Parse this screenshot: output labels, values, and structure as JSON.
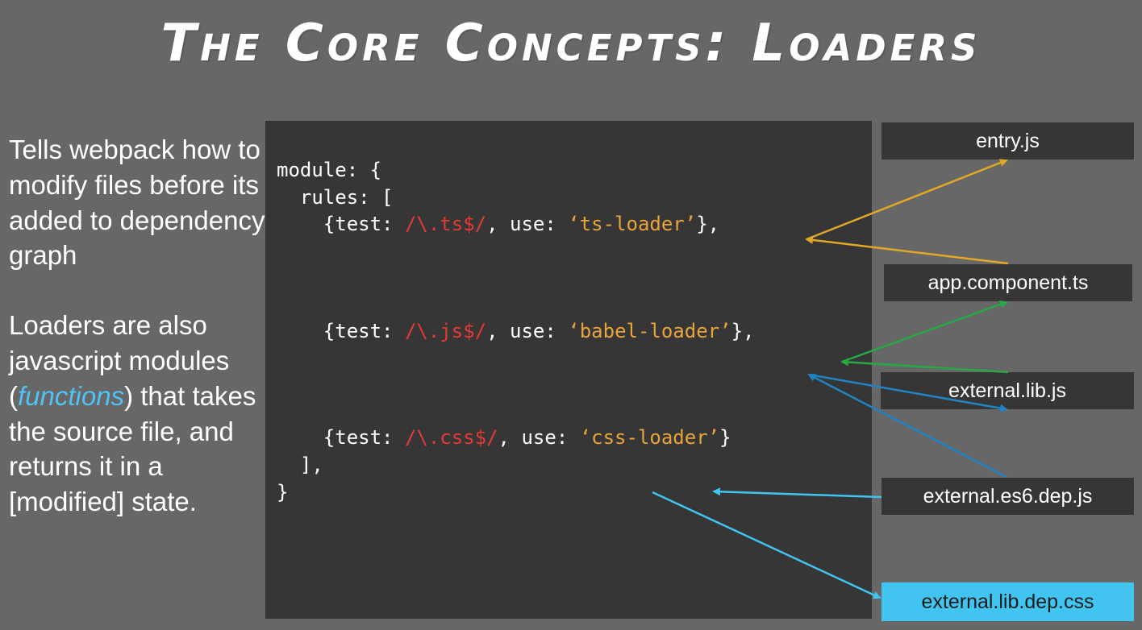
{
  "title": "The Core Concepts: Loaders",
  "description": {
    "p1": "Tells webpack how to modify files before its added to dependency graph",
    "p2_before": "Loaders are also javascript modules (",
    "p2_keyword": "functions",
    "p2_after": ") that takes the source file, and returns it in a [modified] state."
  },
  "code": {
    "line1": "module: {",
    "line2": "  rules: [",
    "rules": [
      {
        "prefix": "    {test: ",
        "regex": "/\\.ts$/",
        "mid": ", use: ",
        "loader": "‘ts-loader’",
        "suffix": "},"
      },
      {
        "prefix": "    {test: ",
        "regex": "/\\.js$/",
        "mid": ", use: ",
        "loader": "‘babel-loader’",
        "suffix": "},"
      },
      {
        "prefix": "    {test: ",
        "regex": "/\\.css$/",
        "mid": ", use: ",
        "loader": "‘css-loader’",
        "suffix": "}"
      }
    ],
    "line_close_rules": "  ],",
    "line_close_module": "}"
  },
  "files": [
    {
      "label": "entry.js"
    },
    {
      "label": "app.component.ts"
    },
    {
      "label": "external.lib.js"
    },
    {
      "label": "external.es6.dep.js"
    },
    {
      "label": "external.lib.dep.css"
    }
  ],
  "colors": {
    "background": "#666766",
    "code_panel": "#363636",
    "regex": "#e53935",
    "loader_string": "#e8a33a",
    "arrow_ts": "#e0a826",
    "arrow_js_green": "#27a844",
    "arrow_js_blue": "#1f83c4",
    "arrow_css": "#41c4f0",
    "highlight_box": "#41c4f0"
  }
}
